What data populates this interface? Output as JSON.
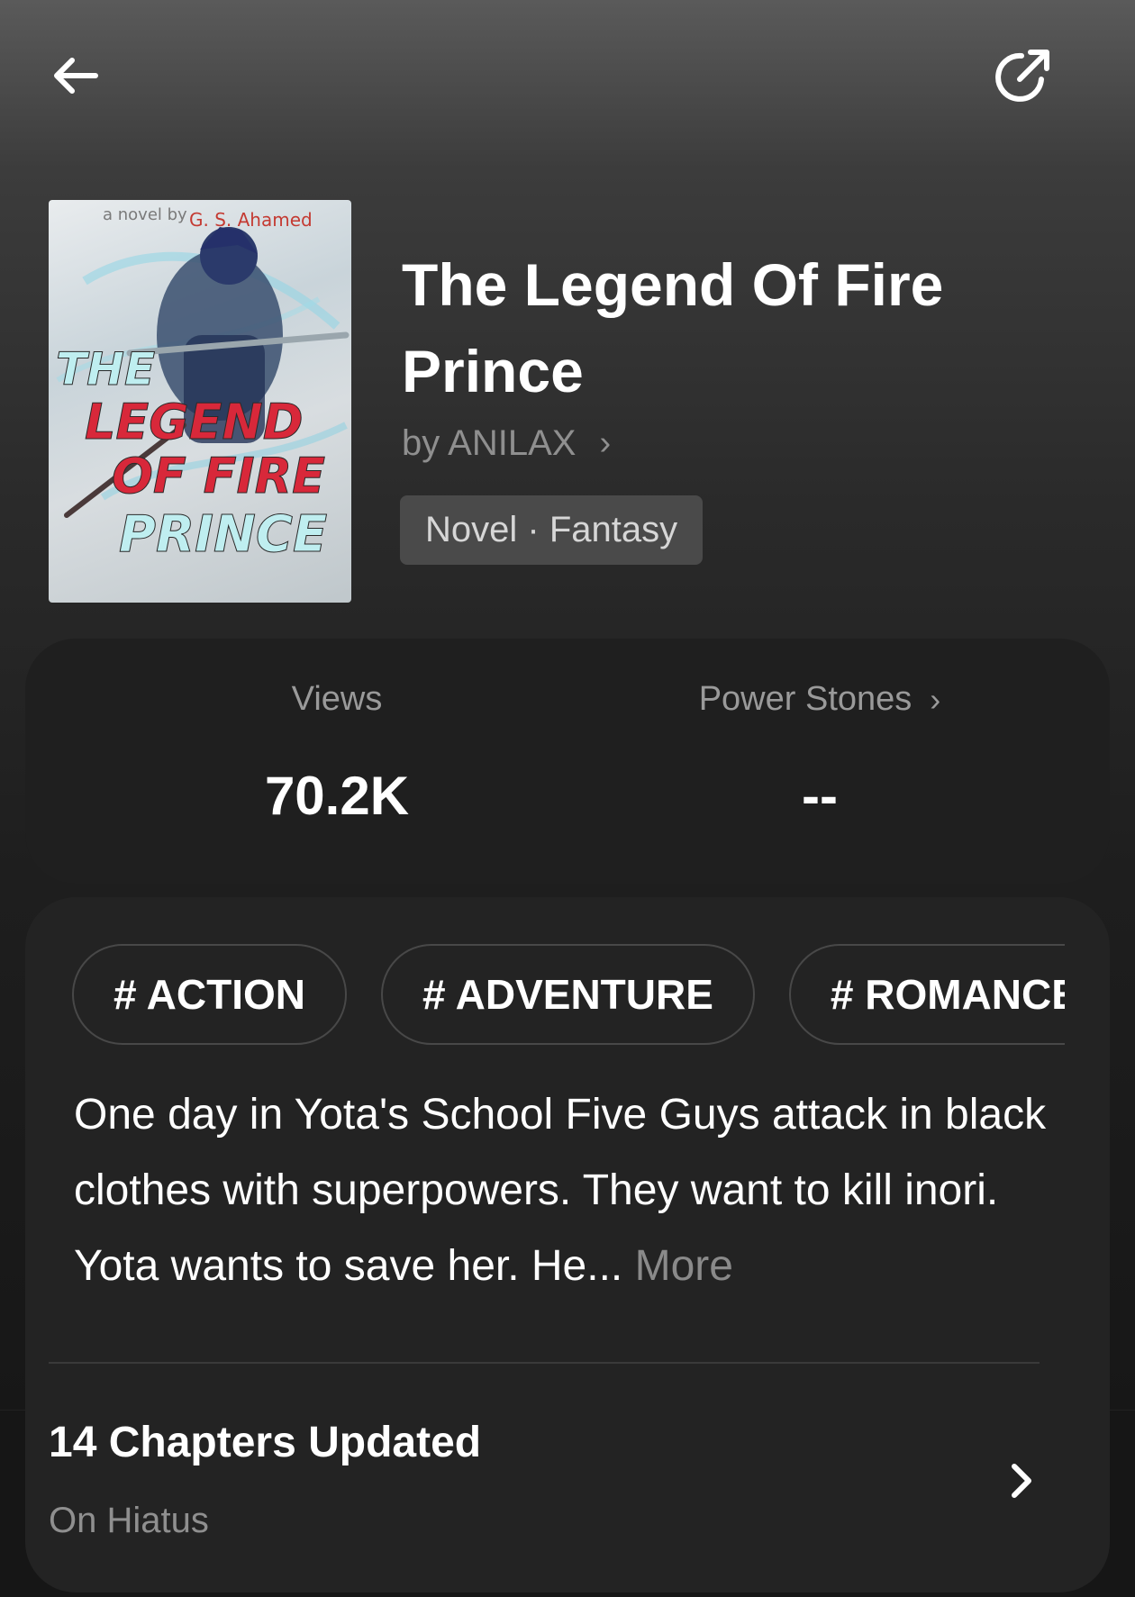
{
  "header": {
    "back_icon": "arrow-left-icon",
    "share_icon": "share-icon"
  },
  "book": {
    "cover": {
      "byline": "a novel by",
      "author": "G. S. Ahamed",
      "title_art_lines": [
        "THE",
        "LEGEND",
        "OF FIRE",
        "PRINCE"
      ]
    },
    "title": "The Legend Of Fire Prince",
    "author_line": "by ANILAX",
    "author_chevron": "›",
    "genre": "Novel · Fantasy"
  },
  "stats": {
    "views_label": "Views",
    "views_value": "70.2K",
    "stones_label": "Power Stones",
    "stones_chevron": "›",
    "stones_value": "--"
  },
  "tags": [
    "# ACTION",
    "# ADVENTURE",
    "# ROMANCE"
  ],
  "synopsis": {
    "text": "One day in Yota's School Five Guys attack in black clothes with superpowers. They want to kill inori. Yota wants to save her. He...",
    "more_label": "More"
  },
  "chapters": {
    "count_text": "14 Chapters Updated",
    "status": "On Hiatus",
    "chevron_icon": "chevron-right-icon"
  },
  "colors": {
    "background": "#141414",
    "card": "#232323",
    "stats_card": "#1f1f1f",
    "muted_text": "#8f8f8f",
    "genre_pill": "#4a4a4a",
    "cover_red": "#d8283a",
    "cover_cyan": "#bfeef0"
  }
}
